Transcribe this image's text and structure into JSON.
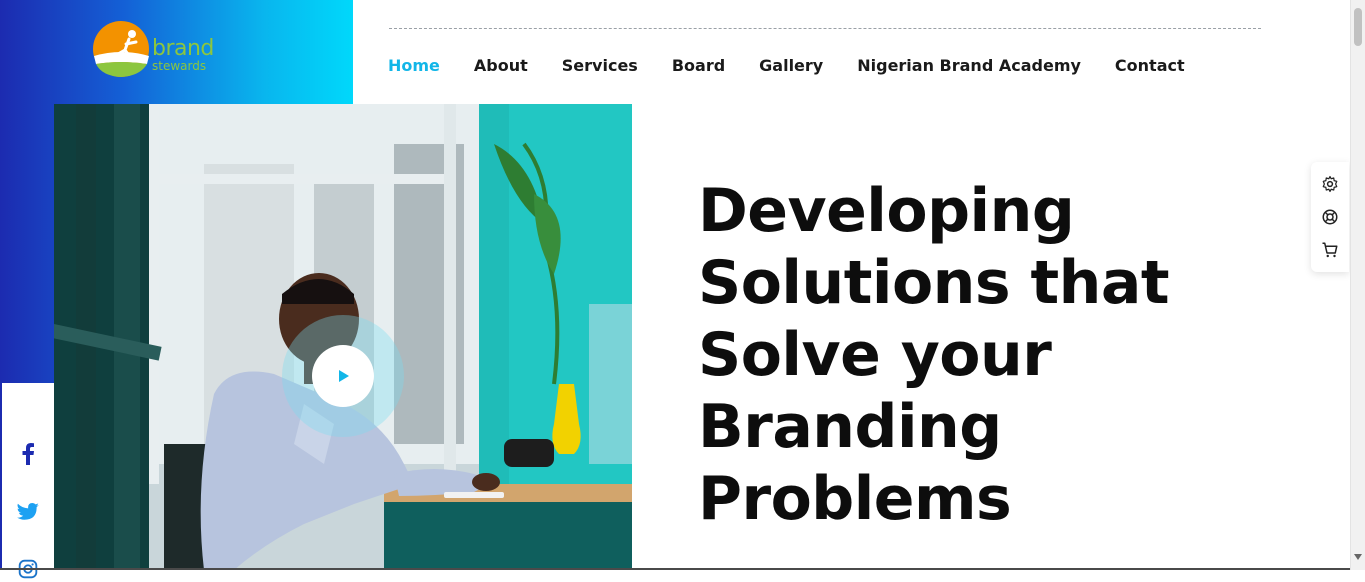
{
  "logo": {
    "line1": "brand",
    "line2": "stewards"
  },
  "nav": {
    "items": [
      {
        "label": "Home",
        "active": true
      },
      {
        "label": "About"
      },
      {
        "label": "Services"
      },
      {
        "label": "Board"
      },
      {
        "label": "Gallery"
      },
      {
        "label": "Nigerian Brand Academy"
      },
      {
        "label": "Contact"
      }
    ]
  },
  "hero": {
    "title_lines": [
      "Developing",
      "Solutions that",
      "Solve your",
      "Branding",
      "Problems"
    ]
  },
  "side_tools": [
    "gear-icon",
    "lifebuoy-icon",
    "cart-icon"
  ],
  "social": [
    "facebook-icon",
    "twitter-icon",
    "instagram-icon"
  ],
  "colors": {
    "accent": "#12b6e8",
    "panel_start": "#1c2bb0",
    "panel_end": "#00d8fb",
    "logo_green": "#8cc63f",
    "logo_orange": "#f39200"
  }
}
